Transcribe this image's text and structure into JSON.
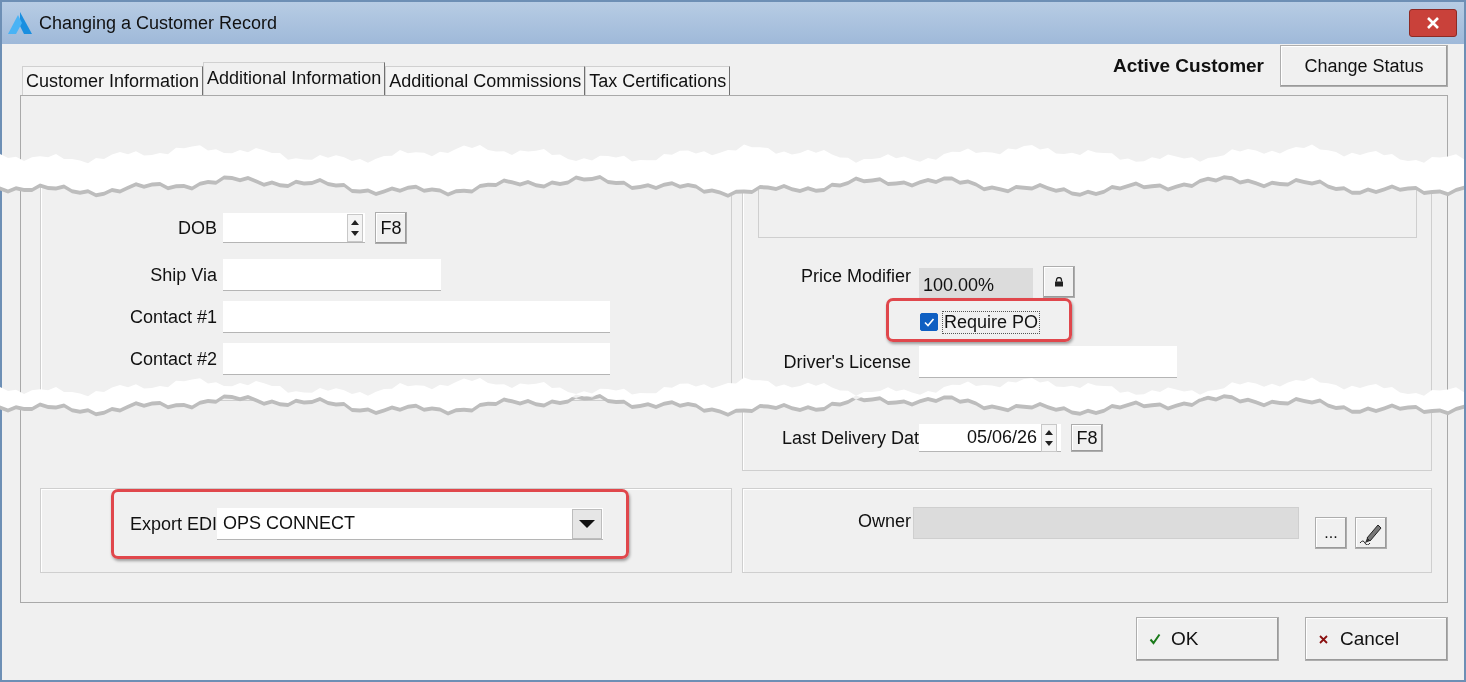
{
  "window": {
    "title": "Changing a Customer Record"
  },
  "tabs": [
    {
      "label": "Customer Information",
      "selected": false
    },
    {
      "label": "Additional Information",
      "selected": true
    },
    {
      "label": "Additional Commissions",
      "selected": false
    },
    {
      "label": "Tax Certifications",
      "selected": false
    }
  ],
  "status": "Active Customer",
  "status_button": "Change Status",
  "left_fields": [
    {
      "kind": "date",
      "label": "DOB",
      "button": "F8"
    },
    {
      "kind": "short",
      "label": "Ship Via"
    },
    {
      "kind": "long",
      "label": "Contact #1"
    },
    {
      "kind": "long",
      "label": "Contact #2"
    }
  ],
  "price_modifier": {
    "label": "Price Modifier",
    "value": "100.00%"
  },
  "require_po": {
    "label": "Require PO",
    "checked": true,
    "highlighted": true
  },
  "drivers_license": {
    "label": "Driver's License"
  },
  "last_delivery": {
    "label": "Last Delivery Dat",
    "value": "05/06/26",
    "button": "F8"
  },
  "export_edi": {
    "label": "Export EDI",
    "value": "OPS CONNECT",
    "highlighted": true
  },
  "owner": {
    "label": "Owner",
    "button": "..."
  },
  "buttons": [
    {
      "kind": "ok",
      "label": "OK"
    },
    {
      "kind": "cancel",
      "label": "Cancel"
    }
  ]
}
